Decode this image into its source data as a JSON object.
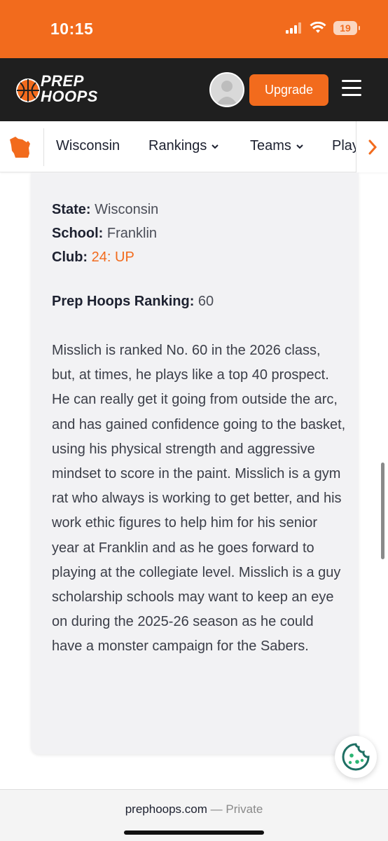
{
  "status_bar": {
    "time": "10:15",
    "battery_level": "19",
    "background_color": "#f26b1d"
  },
  "header": {
    "logo_text_line1": "PREP",
    "logo_text_line2": "HOOPS",
    "upgrade_label": "Upgrade",
    "background_color": "#1f1f1f",
    "accent_color": "#f26b1d"
  },
  "subnav": {
    "state_label": "Wisconsin",
    "rankings_label": "Rankings",
    "teams_label": "Teams",
    "players_label_clipped": "Play",
    "icons": [
      "wisconsin-map-icon",
      "chevron-down-icon",
      "chevron-right-icon"
    ]
  },
  "player_info": {
    "state_key": "State:",
    "state_value": "Wisconsin",
    "school_key": "School:",
    "school_value": "Franklin",
    "club_key": "Club:",
    "club_value": "24: UP",
    "ranking_key": "Prep Hoops Ranking:",
    "ranking_value": "60"
  },
  "article": {
    "body": "Misslich is ranked No. 60 in the 2026 class, but, at times, he plays like a top 40 prospect. He can really get it going from outside the arc, and has gained confidence going to the basket, using his physical strength and aggressive mindset to score in the paint. Misslich is a gym rat who always is working to get better, and his work ethic figures to help him for his senior year at Franklin and as he goes forward to playing at the collegiate level. Misslich is a guy scholarship schools may want to keep an eye on during the 2025-26 season as he could have a monster campaign for the Sabers."
  },
  "browser": {
    "domain": "prephoops.com",
    "separator": " — ",
    "mode": "Private"
  }
}
